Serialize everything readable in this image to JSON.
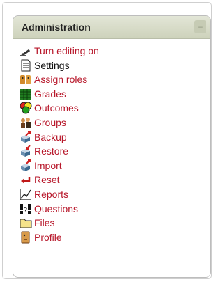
{
  "block": {
    "title": "Administration",
    "toggle_label": "–",
    "items": [
      {
        "label": "Turn editing on",
        "icon": "pencil-icon",
        "link": true
      },
      {
        "label": "Settings",
        "icon": "document-icon",
        "link": false
      },
      {
        "label": "Assign roles",
        "icon": "roles-icon",
        "link": true
      },
      {
        "label": "Grades",
        "icon": "grades-icon",
        "link": true
      },
      {
        "label": "Outcomes",
        "icon": "outcomes-icon",
        "link": true
      },
      {
        "label": "Groups",
        "icon": "groups-icon",
        "link": true
      },
      {
        "label": "Backup",
        "icon": "backup-icon",
        "link": true
      },
      {
        "label": "Restore",
        "icon": "restore-icon",
        "link": true
      },
      {
        "label": "Import",
        "icon": "import-icon",
        "link": true
      },
      {
        "label": "Reset",
        "icon": "reset-icon",
        "link": true
      },
      {
        "label": "Reports",
        "icon": "reports-icon",
        "link": true
      },
      {
        "label": "Questions",
        "icon": "questions-icon",
        "link": true
      },
      {
        "label": "Files",
        "icon": "folder-icon",
        "link": true
      },
      {
        "label": "Profile",
        "icon": "profile-icon",
        "link": true
      }
    ]
  },
  "colors": {
    "link": "#b8182b",
    "header_bg": "#d6dac6"
  }
}
